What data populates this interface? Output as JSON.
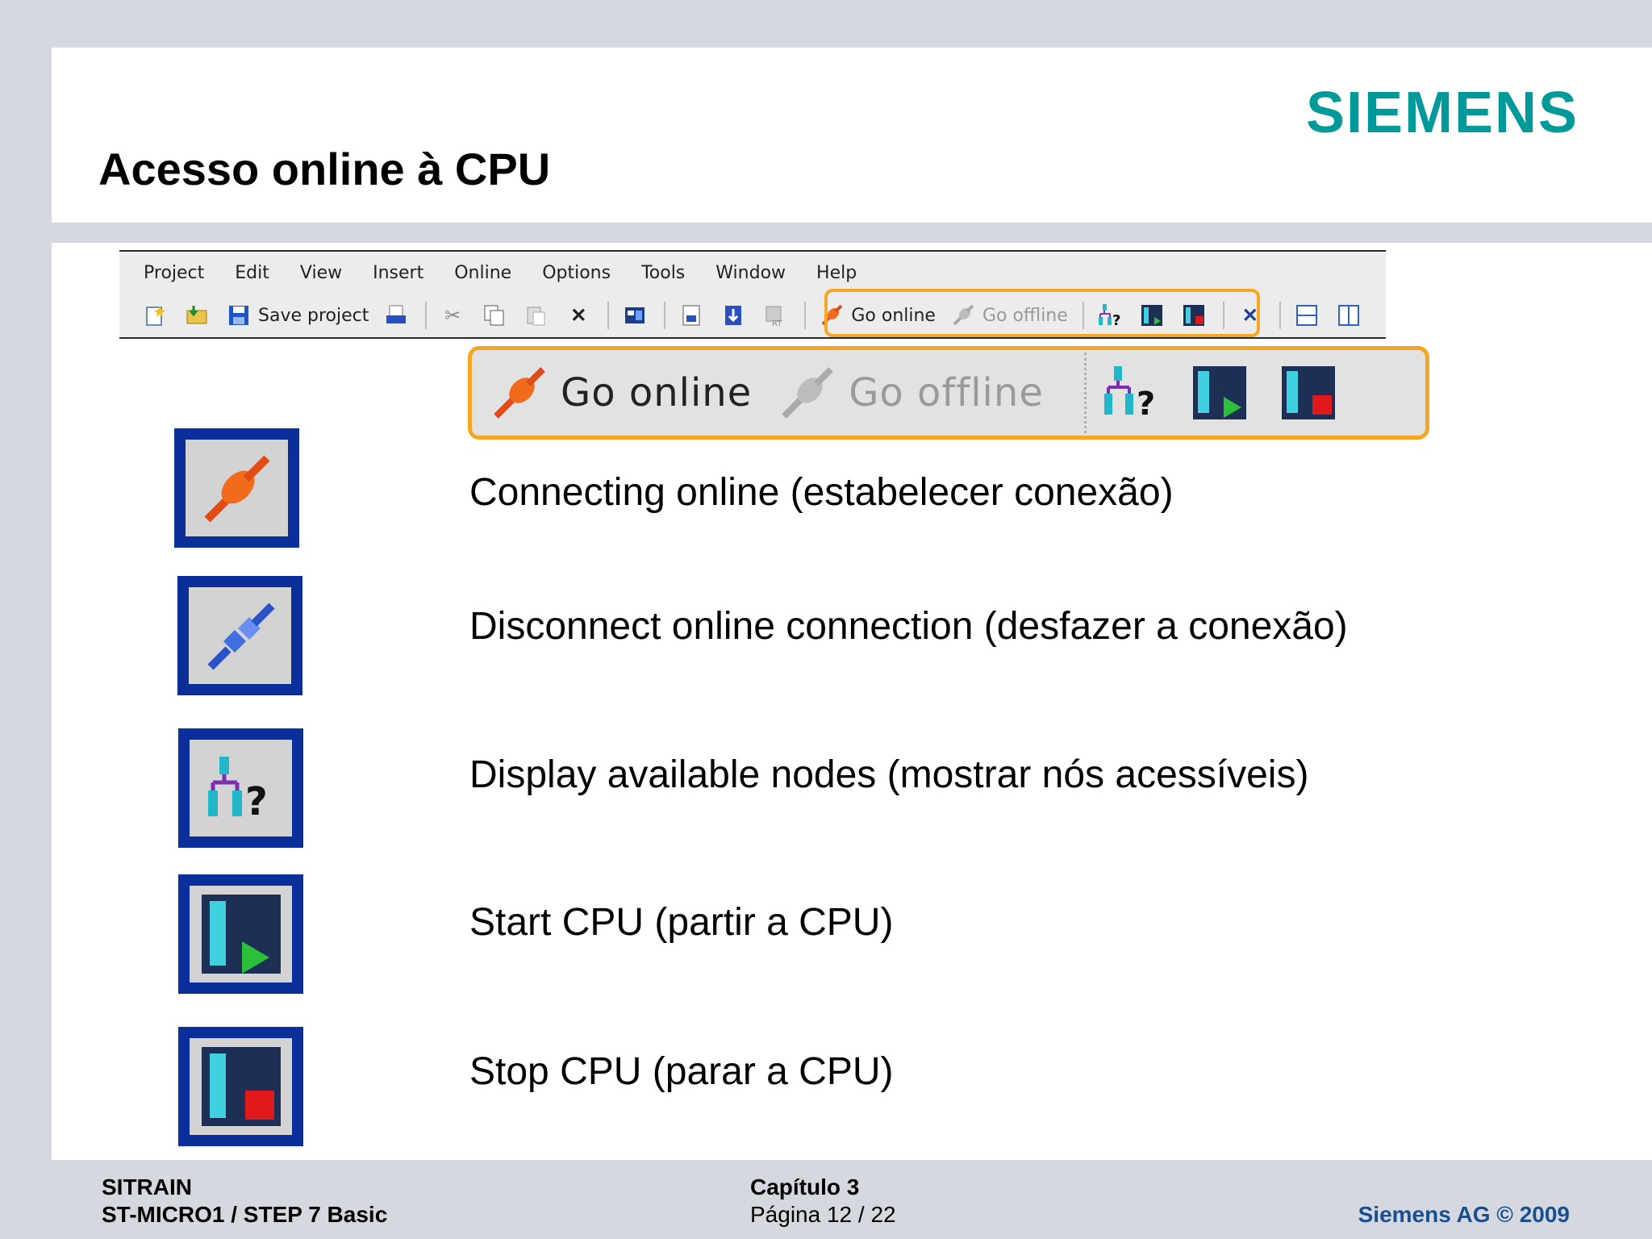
{
  "header": {
    "brand": "SIEMENS",
    "title": "Acesso online à CPU"
  },
  "menubar": {
    "items": [
      "Project",
      "Edit",
      "View",
      "Insert",
      "Online",
      "Options",
      "Tools",
      "Window",
      "Help"
    ]
  },
  "toolbar": {
    "save_label": "Save project",
    "go_online_label": "Go online",
    "go_offline_label": "Go offline"
  },
  "zoom": {
    "go_online_label": "Go online",
    "go_offline_label": "Go offline"
  },
  "legend": [
    {
      "icon": "plug-connect-icon",
      "text": "Connecting online (estabelecer conexão)"
    },
    {
      "icon": "plug-disconnect-icon",
      "text": "Disconnect online connection (desfazer a conexão)"
    },
    {
      "icon": "nodes-search-icon",
      "text": "Display available nodes (mostrar nós acessíveis)"
    },
    {
      "icon": "cpu-start-icon",
      "text": "Start CPU (partir a CPU)"
    },
    {
      "icon": "cpu-stop-icon",
      "text": "Stop CPU (parar a CPU)"
    }
  ],
  "footer": {
    "left_line1": "SITRAIN",
    "left_line2": "ST-MICRO1 / STEP 7 Basic",
    "mid_line1": "Capítulo 3",
    "mid_line2": "Página 12 / 22",
    "right": "Siemens AG © 2009"
  },
  "colors": {
    "brand": "#009999",
    "highlight": "#f5a623",
    "icon_frame": "#0a2f9a",
    "footer_link": "#1a4f8f"
  }
}
